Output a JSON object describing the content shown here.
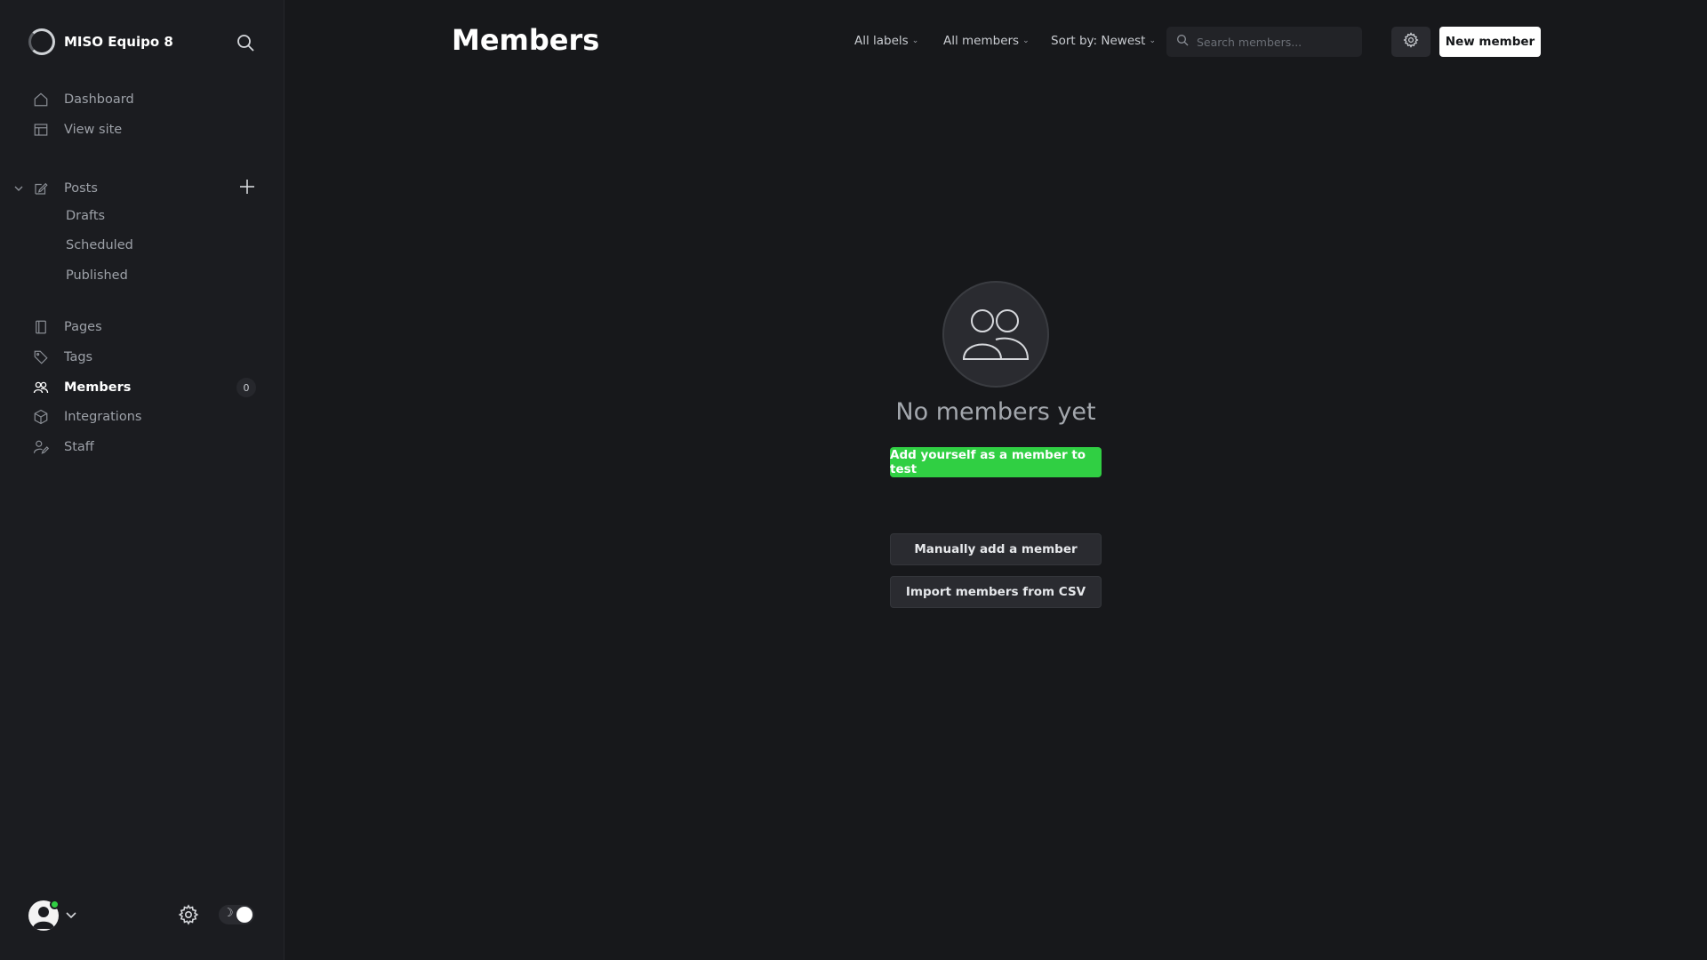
{
  "sidebar": {
    "site_name": "MISO Equipo 8",
    "nav_top": [
      {
        "label": "Dashboard",
        "icon": "home-icon"
      },
      {
        "label": "View site",
        "icon": "layout-icon"
      }
    ],
    "posts": {
      "label": "Posts",
      "icon": "edit-icon",
      "subitems": [
        "Drafts",
        "Scheduled",
        "Published"
      ]
    },
    "nav_bottom": [
      {
        "label": "Pages",
        "icon": "page-icon"
      },
      {
        "label": "Tags",
        "icon": "tag-icon"
      },
      {
        "label": "Members",
        "icon": "members-icon",
        "active": true,
        "count": "0"
      },
      {
        "label": "Integrations",
        "icon": "box-icon"
      },
      {
        "label": "Staff",
        "icon": "staff-icon"
      }
    ],
    "theme_toggle_icon": "☽"
  },
  "header": {
    "title": "Members",
    "filters": {
      "labels": "All labels",
      "members": "All members",
      "sort": "Sort by: Newest"
    },
    "search_placeholder": "Search members...",
    "new_member": "New member"
  },
  "empty_state": {
    "title": "No members yet",
    "add_self": "Add yourself as a member to test",
    "manual_add": "Manually add a member",
    "import_csv": "Import members from CSV"
  },
  "colors": {
    "background": "#17181b",
    "sidebar": "#1b1c20",
    "accent_green": "#30cf43"
  }
}
